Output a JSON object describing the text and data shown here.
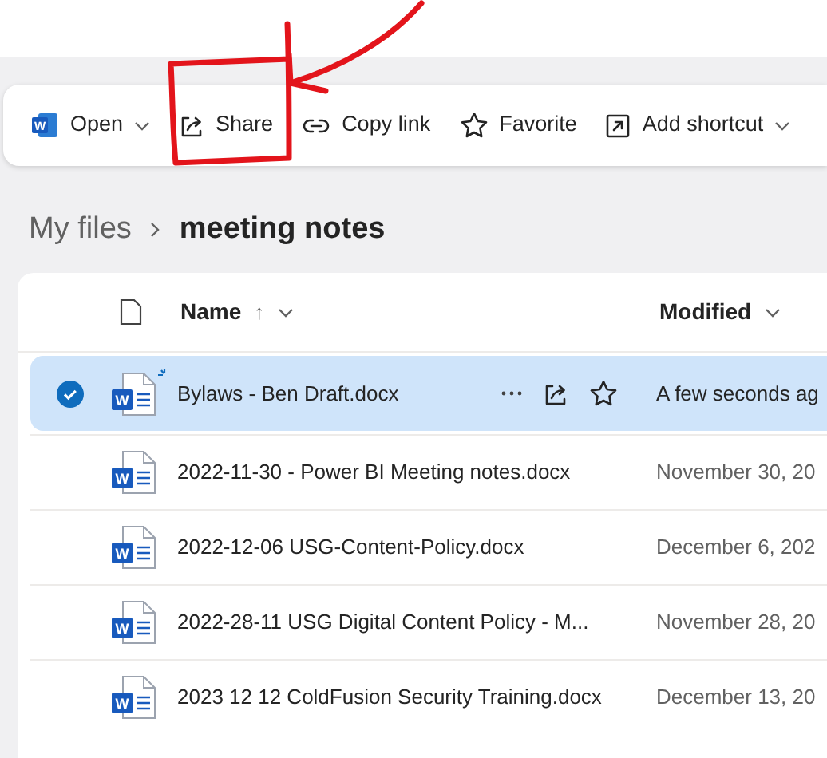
{
  "toolbar": [
    {
      "kind": "word",
      "icon_letter": "W",
      "label": "Open",
      "dropdown": true
    },
    {
      "kind": "share",
      "label": "Share",
      "dropdown": false
    },
    {
      "kind": "link",
      "label": "Copy link",
      "dropdown": false
    },
    {
      "kind": "star",
      "label": "Favorite",
      "dropdown": false
    },
    {
      "kind": "shortcut",
      "label": "Add shortcut",
      "dropdown": true
    }
  ],
  "annotation": {
    "kind": "arrow-box"
  },
  "breadcrumb": [
    "My files",
    "meeting notes"
  ],
  "table": {
    "columns": [
      {
        "label": "Name",
        "sort": "↑"
      },
      {
        "label": "Modified"
      }
    ],
    "rows": [
      {
        "name": "Bylaws - Ben Draft.docx",
        "modified": "A few seconds ag",
        "selected": true,
        "new": true,
        "icon_letter": "W"
      },
      {
        "name": "2022-11-30 - Power BI Meeting notes.docx",
        "modified": "November 30, 20",
        "selected": false,
        "new": false,
        "icon_letter": "W"
      },
      {
        "name": "2022-12-06 USG-Content-Policy.docx",
        "modified": "December 6, 202",
        "selected": false,
        "new": false,
        "icon_letter": "W"
      },
      {
        "name": "2022-28-11 USG Digital Content Policy - M...",
        "modified": "November 28, 20",
        "selected": false,
        "new": false,
        "icon_letter": "W"
      },
      {
        "name": "2023 12 12 ColdFusion Security Training.docx",
        "modified": "December 13, 20",
        "selected": false,
        "new": false,
        "icon_letter": "W"
      }
    ]
  }
}
